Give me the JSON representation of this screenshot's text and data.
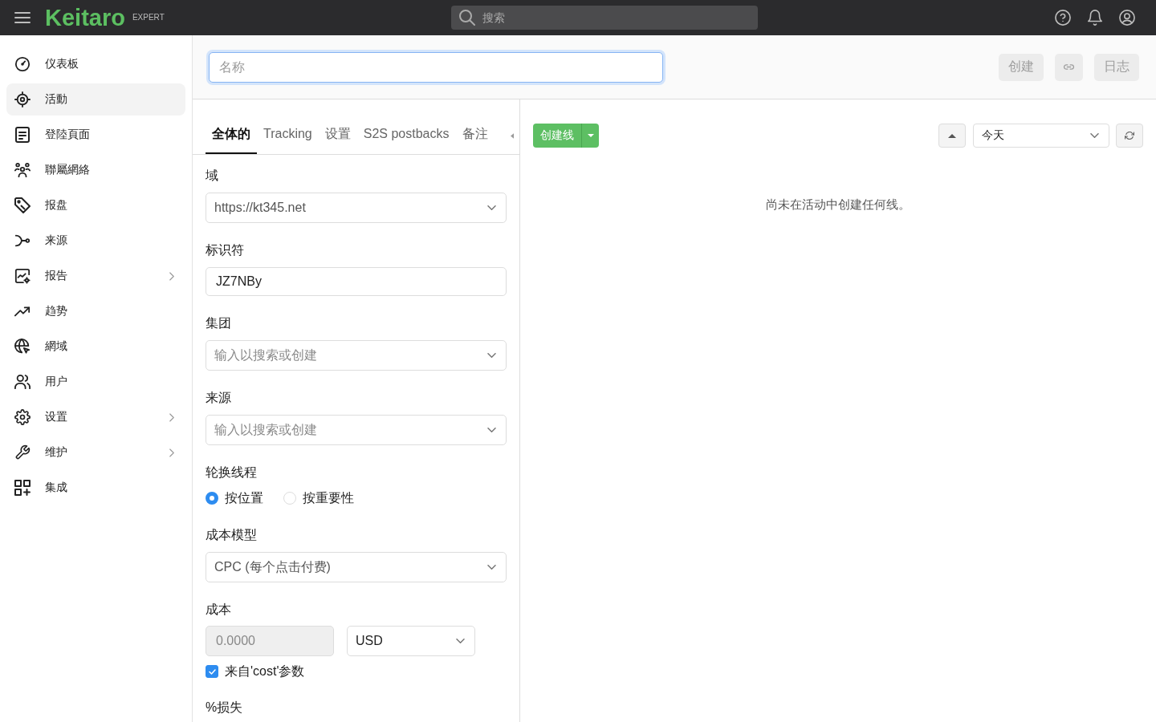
{
  "topbar": {
    "logo": "Keitaro",
    "edition": "EXPERT",
    "search": {
      "placeholder": "搜索"
    }
  },
  "sidebar": {
    "items": [
      {
        "label": "仪表板",
        "selected": false,
        "expandable": false
      },
      {
        "label": "活動",
        "selected": true,
        "expandable": false
      },
      {
        "label": "登陸頁面",
        "selected": false,
        "expandable": false
      },
      {
        "label": "聯屬網絡",
        "selected": false,
        "expandable": false
      },
      {
        "label": "报盘",
        "selected": false,
        "expandable": false
      },
      {
        "label": "来源",
        "selected": false,
        "expandable": false
      },
      {
        "label": "报告",
        "selected": false,
        "expandable": true
      },
      {
        "label": "趋势",
        "selected": false,
        "expandable": false
      },
      {
        "label": "網域",
        "selected": false,
        "expandable": false
      },
      {
        "label": "用户",
        "selected": false,
        "expandable": false
      },
      {
        "label": "设置",
        "selected": false,
        "expandable": true
      },
      {
        "label": "维护",
        "selected": false,
        "expandable": true
      },
      {
        "label": "集成",
        "selected": false,
        "expandable": false
      }
    ]
  },
  "header": {
    "name_field": {
      "placeholder": "名称",
      "focused": true
    },
    "buttons": [
      {
        "kind": "text",
        "label": "创建",
        "disabled": true
      },
      {
        "kind": "icon",
        "disabled": true
      },
      {
        "kind": "text",
        "label": "日志",
        "disabled": true
      }
    ]
  },
  "tabs": [
    {
      "label": "全体的",
      "selected": true
    },
    {
      "label": "Tracking",
      "selected": false
    },
    {
      "label": "设置",
      "selected": false
    },
    {
      "label": "S2S postbacks",
      "selected": false
    },
    {
      "label": "备注",
      "selected": false
    }
  ],
  "form": {
    "fields": [
      {
        "kind": "select",
        "label": "域",
        "value": "https://kt345.net"
      },
      {
        "kind": "text",
        "label": "标识符",
        "value": "JZ7NBy"
      },
      {
        "kind": "select",
        "label": "集团",
        "placeholder": "输入以搜索或创建"
      },
      {
        "kind": "select",
        "label": "来源",
        "placeholder": "输入以搜索或创建"
      },
      {
        "kind": "radio",
        "label": "轮换线程",
        "options": [
          {
            "label": "按位置",
            "selected": true
          },
          {
            "label": "按重要性",
            "selected": false
          }
        ]
      },
      {
        "kind": "select",
        "label": "成本模型",
        "value": "CPC (每个点击付费)"
      },
      {
        "kind": "cost",
        "label": "成本",
        "amount": {
          "value": "0.0000",
          "disabled": true
        },
        "currency": {
          "value": "USD"
        },
        "checkbox": {
          "label": "来自'cost'参数",
          "checked": true
        }
      },
      {
        "kind": "label",
        "label": "%损失"
      }
    ]
  },
  "lines_panel": {
    "create_button": {
      "label": "创建线"
    },
    "period": {
      "value": "今天"
    },
    "empty_message": "尚未在活动中创建任何线。"
  }
}
